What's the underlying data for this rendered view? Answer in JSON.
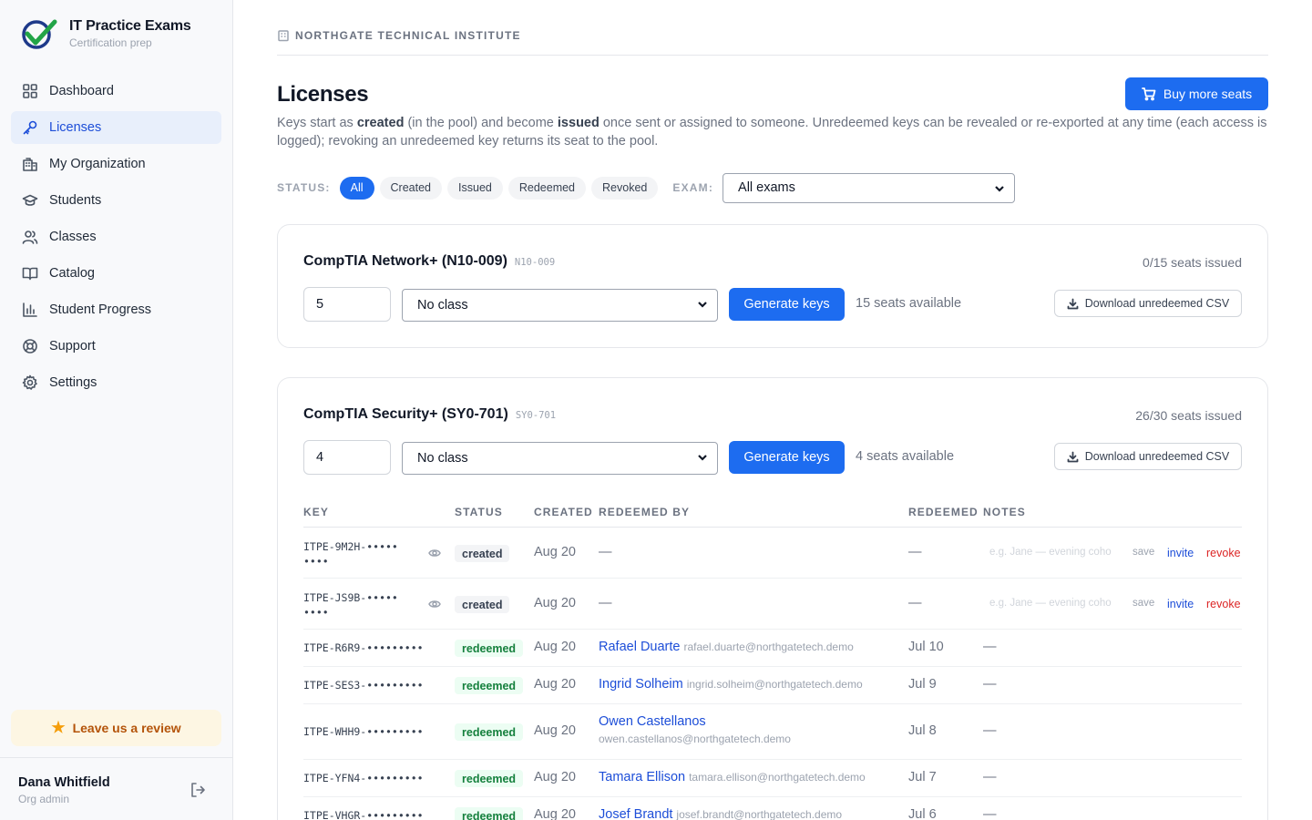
{
  "brand": {
    "name": "IT Practice Exams",
    "tagline": "Certification prep"
  },
  "nav": {
    "items": [
      {
        "label": "Dashboard",
        "icon": "grid-icon"
      },
      {
        "label": "Licenses",
        "icon": "key-icon",
        "active": true
      },
      {
        "label": "My Organization",
        "icon": "building-icon"
      },
      {
        "label": "Students",
        "icon": "graduation-cap-icon"
      },
      {
        "label": "Classes",
        "icon": "users-icon"
      },
      {
        "label": "Catalog",
        "icon": "book-open-icon"
      },
      {
        "label": "Student Progress",
        "icon": "bar-chart-icon"
      },
      {
        "label": "Support",
        "icon": "life-buoy-icon"
      },
      {
        "label": "Settings",
        "icon": "gear-icon"
      }
    ]
  },
  "review": {
    "label": "Leave us a review",
    "icon": "star-icon"
  },
  "user": {
    "name": "Dana Whitfield",
    "role": "Org admin"
  },
  "org": {
    "name": "NORTHGATE TECHNICAL INSTITUTE"
  },
  "page": {
    "title": "Licenses",
    "buy_label": "Buy more seats",
    "desc_1": "Keys start as ",
    "desc_created": "created",
    "desc_2": " (in the pool) and become ",
    "desc_issued": "issued",
    "desc_3": " once sent or assigned to someone. Unredeemed keys can be revealed or re-exported at any time (each access is logged); revoking an unredeemed key returns its seat to the pool."
  },
  "filters": {
    "status_label": "STATUS:",
    "chips": [
      "All",
      "Created",
      "Issued",
      "Redeemed",
      "Revoked"
    ],
    "active_chip": "All",
    "exam_label": "EXAM:",
    "exam_value": "All exams"
  },
  "cards": [
    {
      "title": "CompTIA Network+ (N10-009)",
      "code": "N10-009",
      "seats": "0/15 seats issued",
      "qty": "5",
      "class_value": "No class",
      "generate_label": "Generate keys",
      "available": "15 seats available",
      "download_label": "Download unredeemed CSV"
    },
    {
      "title": "CompTIA Security+ (SY0-701)",
      "code": "SY0-701",
      "seats": "26/30 seats issued",
      "qty": "4",
      "class_value": "No class",
      "generate_label": "Generate keys",
      "available": "4 seats available",
      "download_label": "Download unredeemed CSV"
    }
  ],
  "table": {
    "headers": [
      "KEY",
      "STATUS",
      "CREATED",
      "REDEEMED BY",
      "REDEEMED",
      "NOTES"
    ],
    "note_placeholder": "e.g. Jane — evening coho",
    "save_label": "save",
    "invite_label": "invite",
    "revoke_label": "revoke",
    "dash": "—",
    "rows": [
      {
        "key_1": "ITPE-9M2H-•••••",
        "key_2": "••••",
        "status": "created",
        "created": "Aug 20"
      },
      {
        "key_1": "ITPE-JS9B-•••••",
        "key_2": "••••",
        "status": "created",
        "created": "Aug 20"
      },
      {
        "key": "ITPE-R6R9-•••••••••",
        "status": "redeemed",
        "created": "Aug 20",
        "name": "Rafael Duarte",
        "email": "rafael.duarte@northgatetech.demo",
        "redeemed": "Jul 10"
      },
      {
        "key": "ITPE-SES3-•••••••••",
        "status": "redeemed",
        "created": "Aug 20",
        "name": "Ingrid Solheim",
        "email": "ingrid.solheim@northgatetech.demo",
        "redeemed": "Jul 9"
      },
      {
        "key": "ITPE-WHH9-•••••••••",
        "status": "redeemed",
        "created": "Aug 20",
        "name": "Owen Castellanos",
        "email": "owen.castellanos@northgatetech.demo",
        "redeemed": "Jul 8"
      },
      {
        "key": "ITPE-YFN4-•••••••••",
        "status": "redeemed",
        "created": "Aug 20",
        "name": "Tamara Ellison",
        "email": "tamara.ellison@northgatetech.demo",
        "redeemed": "Jul 7"
      },
      {
        "key": "ITPE-VHGR-•••••••••",
        "status": "redeemed",
        "created": "Aug 20",
        "name": "Josef Brandt",
        "email": "josef.brandt@northgatetech.demo",
        "redeemed": "Jul 6"
      }
    ]
  },
  "colors": {
    "accent": "#1d6cf0",
    "active_nav_bg": "#e8effb",
    "redeemed_text": "#15803d",
    "revoke_text": "#dc2626",
    "review_bg": "#fdf6e3"
  }
}
